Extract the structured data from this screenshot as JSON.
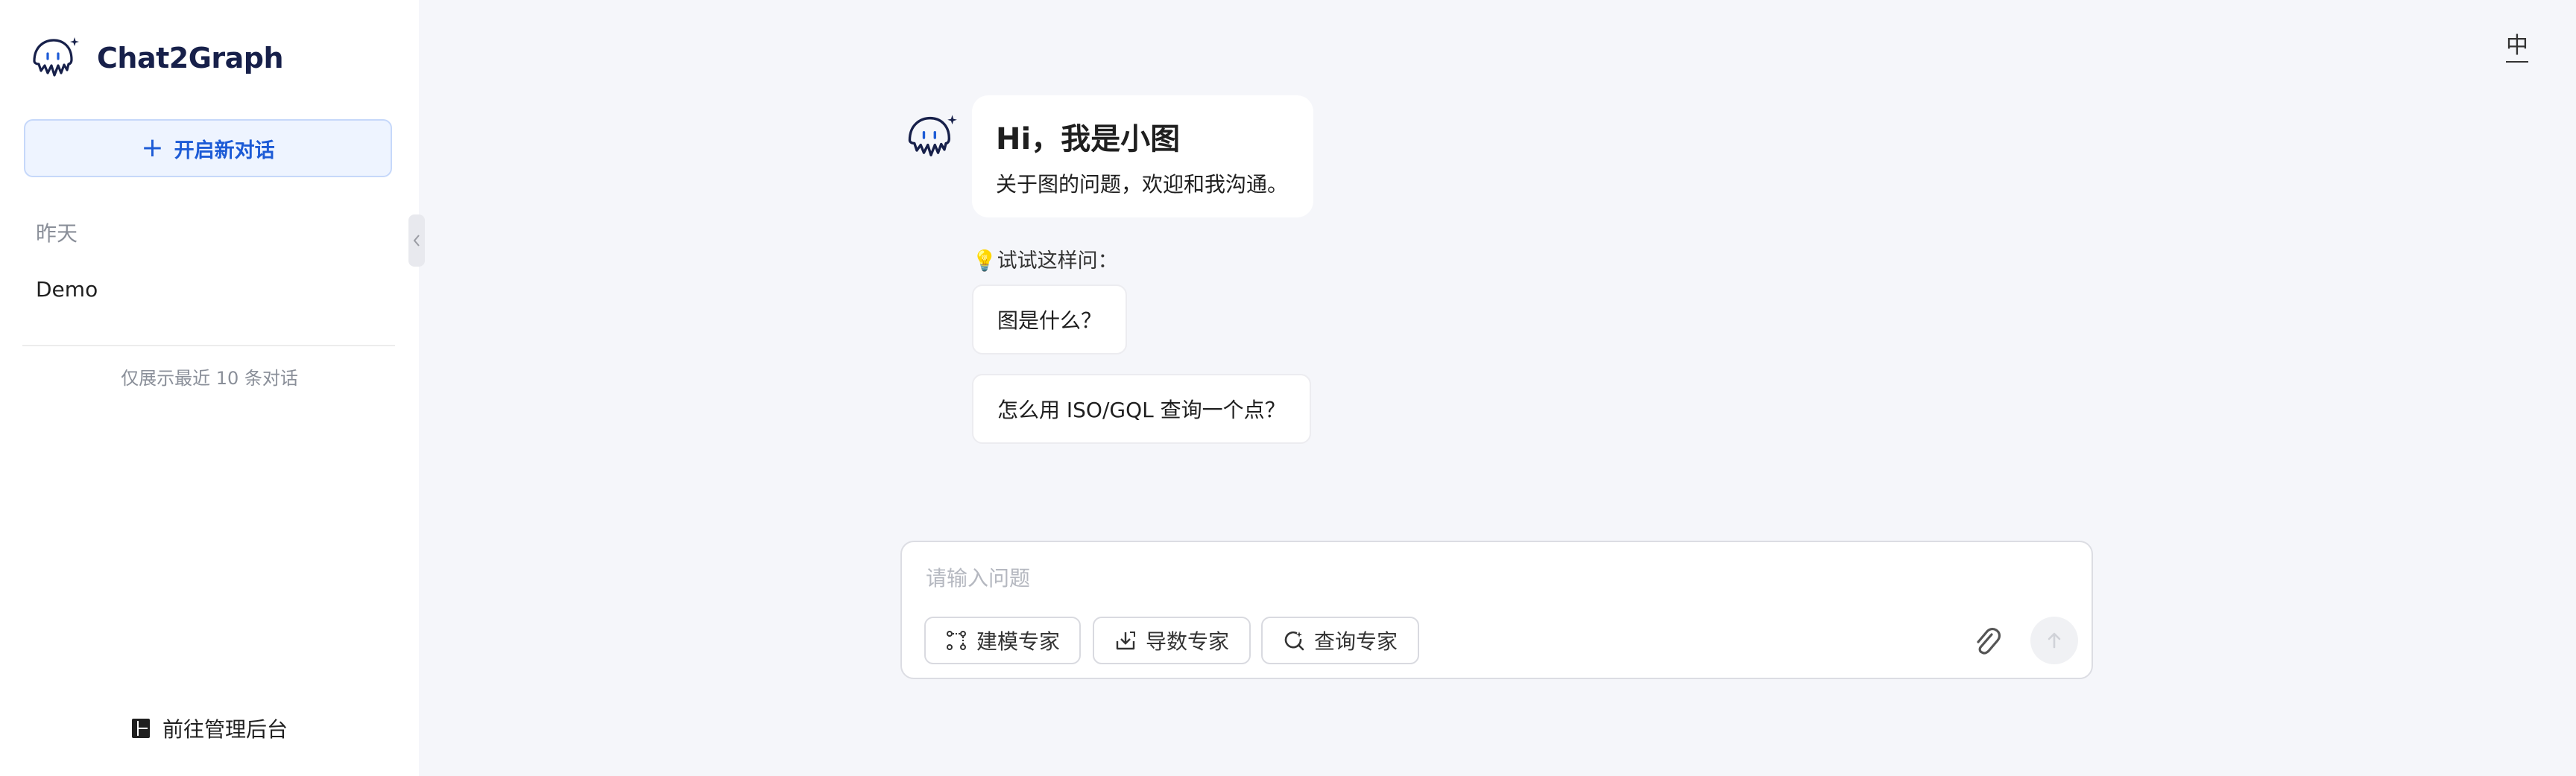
{
  "app": {
    "name": "Chat2Graph"
  },
  "sidebar": {
    "new_chat_label": "开启新对话",
    "section_label": "昨天",
    "conversations": [
      {
        "title": "Demo"
      }
    ],
    "recent_note": "仅展示最近 10 条对话",
    "admin_link_label": "前往管理后台"
  },
  "header": {
    "language_toggle": "中"
  },
  "welcome": {
    "title": "Hi，我是小图",
    "subtitle": "关于图的问题，欢迎和我沟通。",
    "try_label": "💡试试这样问：",
    "suggestions": [
      {
        "text": "图是什么？"
      },
      {
        "text": "怎么用 ISO/GQL 查询一个点？"
      }
    ]
  },
  "composer": {
    "placeholder": "请输入问题",
    "experts": [
      {
        "label": "建模专家",
        "icon": "modeling-icon"
      },
      {
        "label": "导数专家",
        "icon": "import-icon"
      },
      {
        "label": "查询专家",
        "icon": "query-icon"
      }
    ],
    "attach_icon": "paperclip-icon",
    "send_icon": "arrow-up-icon"
  },
  "colors": {
    "accent": "#1d5bd6",
    "brand_text": "#17204a",
    "page_background": "#f5f6fa"
  }
}
